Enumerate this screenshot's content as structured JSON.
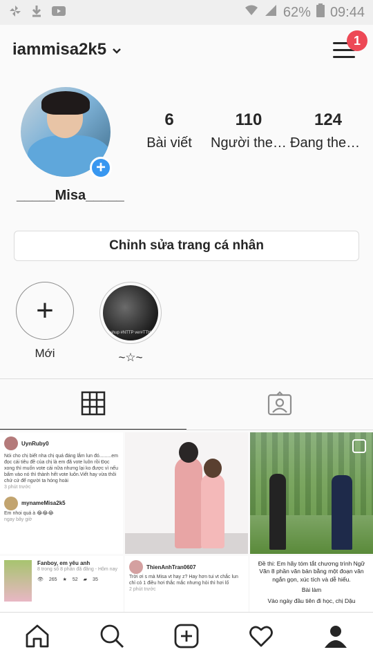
{
  "status_bar": {
    "battery_percent": "62%",
    "time": "09:44"
  },
  "header": {
    "username": "iammisa2k5",
    "notification_count": "1"
  },
  "profile": {
    "display_name": "_____Misa_____",
    "stats": [
      {
        "value": "6",
        "label": "Bài viết"
      },
      {
        "value": "110",
        "label": "Người theo dõi"
      },
      {
        "value": "124",
        "label": "Đang theo dõi"
      }
    ],
    "edit_button_label": "Chỉnh sửa trang cá nhân"
  },
  "highlights": [
    {
      "label": "Mới"
    },
    {
      "label": "~☆~",
      "caption": "Mashup #NTTP ver#TTHKK"
    }
  ],
  "tabs": [
    "grid",
    "tagged"
  ],
  "posts": [
    {
      "type": "comment_screenshot",
      "user": "UynRuby0",
      "text": "Nói cho chị biết nha chị quá đáng lắm lun đó.........em đọc cái tiêu đề của chị là em đã vote luôn rồi Đọc xong thì muốn vote cái nữa nhưng lại ko được vì nếu bấm vào nó thì thành hết vote luôn.Viết hay vừa thôi chứ cứ để người ta hóng hoài",
      "time": "3 phút trước",
      "reply_user": "mynameMisa2k5",
      "reply_text": "Em nhoi quá à 😂😂😂",
      "reply_time": "ngay bây giờ"
    },
    {
      "type": "photo"
    },
    {
      "type": "photo",
      "multi": true
    },
    {
      "type": "post_card",
      "user": "Fanboy, em yêu anh",
      "meta": "8 trong số 8 phần đã đăng - Hôm nay",
      "views": "265",
      "votes": "52",
      "comments": "35"
    },
    {
      "type": "comment_screenshot",
      "user": "ThienAnhTran0607",
      "text": "Trời ơi s mà Misa vt hay z? Hay hơn tui vt chắc lun chỉ có 1 điều hơi thắc mắc nhưng hỏi thì hơi lố",
      "time": "2 phút trước"
    },
    {
      "type": "text",
      "text": "Đề thi: Em hãy tóm tắt chương trình Ngữ Văn 8 phần văn bản bằng một đoạn văn ngắn gọn, xúc tích và dễ hiểu.",
      "subtitle": "Bài làm",
      "body": "Vào ngày đầu tiên đi học, chị Dậu"
    }
  ],
  "bottom_nav": [
    "home",
    "search",
    "new-post",
    "activity",
    "profile"
  ]
}
